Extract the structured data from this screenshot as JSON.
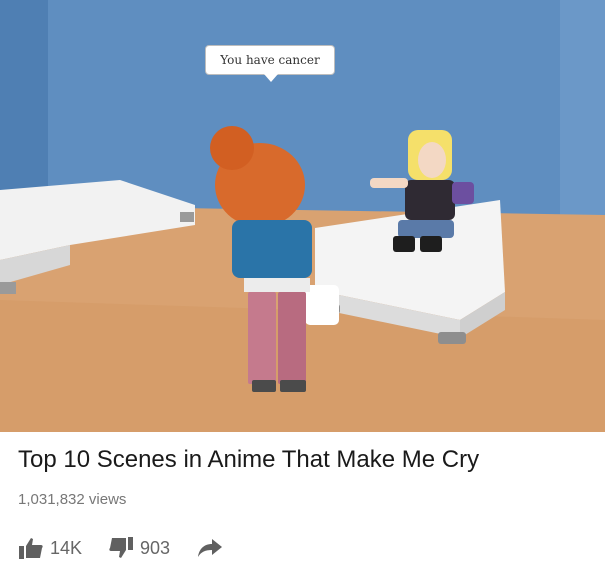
{
  "thumbnail": {
    "speech_bubble": "You have cancer"
  },
  "video": {
    "title": "Top 10 Scenes in Anime That Make Me Cry",
    "views": "1,031,832 views"
  },
  "actions": {
    "like_count": "14K",
    "dislike_count": "903",
    "icons": [
      "thumbs-up-icon",
      "thumbs-down-icon",
      "share-icon"
    ]
  }
}
